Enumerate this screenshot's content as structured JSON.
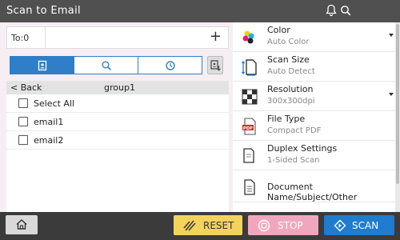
{
  "app": {
    "title": "Scan to Email"
  },
  "header": {
    "icons": [
      "bell-icon",
      "search-icon"
    ]
  },
  "recipient": {
    "label": "To:0",
    "add_glyph": "+"
  },
  "address_tabs": {
    "icons": [
      "address-book-icon",
      "search-icon",
      "history-icon"
    ],
    "active_index": 0
  },
  "list": {
    "back_label": "< Back",
    "group_label": "group1",
    "rows": [
      {
        "label": "Select All",
        "checked": false
      },
      {
        "label": "email1",
        "checked": false
      },
      {
        "label": "email2",
        "checked": false
      }
    ]
  },
  "settings": {
    "items": [
      {
        "title": "Color",
        "value": "Auto Color",
        "icon": "color-icon",
        "dropdown": true
      },
      {
        "title": "Scan Size",
        "value": "Auto Detect",
        "icon": "scan-size-icon",
        "dropdown": false
      },
      {
        "title": "Resolution",
        "value": "300x300dpi",
        "icon": "resolution-icon",
        "dropdown": true
      },
      {
        "title": "File Type",
        "value": "Compact PDF",
        "icon": "pdf-file-icon",
        "dropdown": false
      },
      {
        "title": "Duplex Settings",
        "value": "1-Sided Scan",
        "icon": "duplex-icon",
        "dropdown": false
      },
      {
        "title": "Document Name/Subject/Other",
        "value": "",
        "icon": "document-icon",
        "dropdown": false
      }
    ]
  },
  "bottom": {
    "reset_label": "RESET",
    "stop_label": "STOP",
    "scan_label": "SCAN"
  },
  "colors": {
    "titlebar": "#505050",
    "accent": "#2f7fc8",
    "reset": "#f3d35c",
    "stop": "#f0a7bd",
    "scan": "#1f7ccf"
  }
}
